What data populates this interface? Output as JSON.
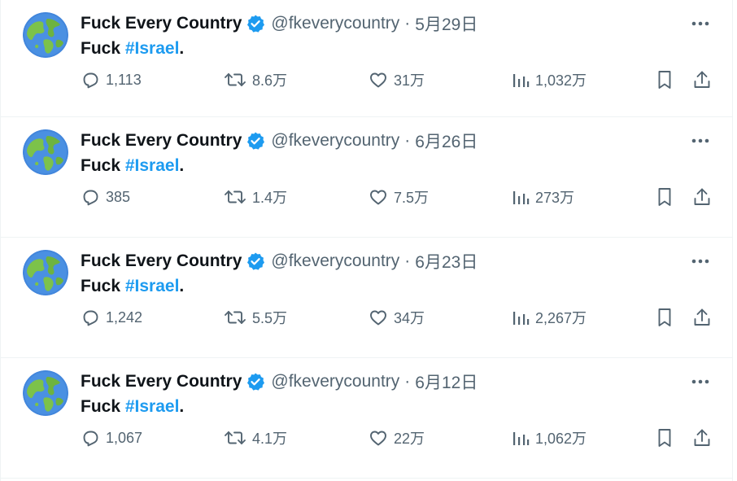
{
  "colors": {
    "text_primary": "#0f1419",
    "text_secondary": "#536471",
    "accent": "#1d9bf0",
    "divider": "#eff3f4"
  },
  "icons": {
    "avatar": "earth-globe-icon",
    "verified": "verified-badge-icon",
    "more": "more-dots-icon",
    "reply": "reply-icon",
    "retweet": "retweet-icon",
    "like": "heart-icon",
    "views": "views-bar-chart-icon",
    "bookmark": "bookmark-icon",
    "share": "share-icon"
  },
  "tweets": [
    {
      "display_name": "Fuck Every Country",
      "handle": "@fkeverycountry",
      "separator": "·",
      "date": "5月29日",
      "text_prefix": "Fuck ",
      "hashtag": "#Israel",
      "text_suffix": ".",
      "replies": "1,113",
      "retweets": "8.6万",
      "likes": "31万",
      "views": "1,032万"
    },
    {
      "display_name": "Fuck Every Country",
      "handle": "@fkeverycountry",
      "separator": "·",
      "date": "6月26日",
      "text_prefix": "Fuck ",
      "hashtag": "#Israel",
      "text_suffix": ".",
      "replies": "385",
      "retweets": "1.4万",
      "likes": "7.5万",
      "views": "273万"
    },
    {
      "display_name": "Fuck Every Country",
      "handle": "@fkeverycountry",
      "separator": "·",
      "date": "6月23日",
      "text_prefix": "Fuck ",
      "hashtag": "#Israel",
      "text_suffix": ".",
      "replies": "1,242",
      "retweets": "5.5万",
      "likes": "34万",
      "views": "2,267万"
    },
    {
      "display_name": "Fuck Every Country",
      "handle": "@fkeverycountry",
      "separator": "·",
      "date": "6月12日",
      "text_prefix": "Fuck ",
      "hashtag": "#Israel",
      "text_suffix": ".",
      "replies": "1,067",
      "retweets": "4.1万",
      "likes": "22万",
      "views": "1,062万"
    }
  ]
}
